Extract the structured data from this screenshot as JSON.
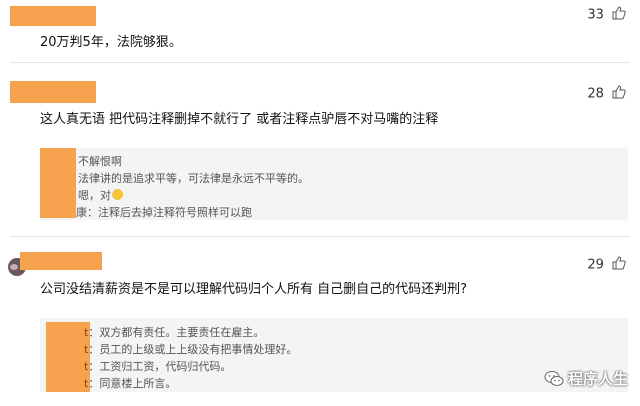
{
  "comments": [
    {
      "text": "20万判5年，法院够狠。",
      "likes": "33"
    },
    {
      "text": "这人真无语 把代码注释删掉不就行了 或者注释点驴唇不对马嘴的注释",
      "likes": "28",
      "replies": [
        "不解恨啊",
        "法律讲的是追求平等，可法律是永远不平等的。",
        "嗯，对",
        "注释后去掉注释符号照样可以跑"
      ],
      "reply_prefixes": [
        "",
        "",
        "",
        "康："
      ]
    },
    {
      "text": "公司没结清薪资是不是可以理解代码归个人所有 自己删自己的代码还判刑?",
      "likes": "29",
      "replies": [
        "双方都有责任。主要责任在雇主。",
        "员工的上级或上上级没有把事情处理好。",
        "工资归工资，代码归代码。",
        "同意楼上所言。"
      ],
      "reply_prefixes": [
        "t：",
        "t：",
        "t：",
        "t："
      ]
    }
  ],
  "watermark": {
    "text": "程序人生",
    "icon": "wechat-icon"
  },
  "colors": {
    "redaction": "#f6a24e",
    "reply_bg": "#f4f4f4"
  }
}
